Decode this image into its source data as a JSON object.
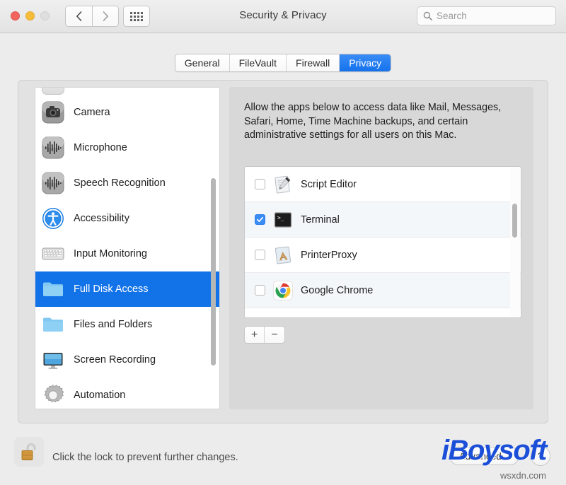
{
  "window": {
    "title": "Security & Privacy",
    "traffic_lights": [
      "close",
      "minimize",
      "zoom"
    ],
    "nav": {
      "back": "‹",
      "forward": "›",
      "grid": "grid-icon"
    }
  },
  "search": {
    "placeholder": "Search",
    "value": "",
    "icon": "search-icon"
  },
  "tabs": [
    {
      "label": "General",
      "active": false
    },
    {
      "label": "FileVault",
      "active": false
    },
    {
      "label": "Firewall",
      "active": false
    },
    {
      "label": "Privacy",
      "active": true
    }
  ],
  "sidebar": {
    "items": [
      {
        "label": "Camera",
        "icon": "camera-icon",
        "selected": false
      },
      {
        "label": "Microphone",
        "icon": "microphone-icon",
        "selected": false
      },
      {
        "label": "Speech Recognition",
        "icon": "speech-waveform-icon",
        "selected": false
      },
      {
        "label": "Accessibility",
        "icon": "accessibility-icon",
        "selected": false
      },
      {
        "label": "Input Monitoring",
        "icon": "keyboard-icon",
        "selected": false
      },
      {
        "label": "Full Disk Access",
        "icon": "folder-icon",
        "selected": true
      },
      {
        "label": "Files and Folders",
        "icon": "folder-icon",
        "selected": false
      },
      {
        "label": "Screen Recording",
        "icon": "display-icon",
        "selected": false
      },
      {
        "label": "Automation",
        "icon": "gear-icon",
        "selected": false
      }
    ]
  },
  "pane": {
    "description": "Allow the apps below to access data like Mail, Messages, Safari, Home, Time Machine backups, and certain administrative settings for all users on this Mac.",
    "apps": [
      {
        "name": "Script Editor",
        "icon": "script-editor-icon",
        "checked": false
      },
      {
        "name": "Terminal",
        "icon": "terminal-icon",
        "checked": true
      },
      {
        "name": "PrinterProxy",
        "icon": "printer-proxy-icon",
        "checked": false
      },
      {
        "name": "Google Chrome",
        "icon": "chrome-icon",
        "checked": false
      }
    ],
    "add_label": "+",
    "remove_label": "−"
  },
  "footer": {
    "lock_icon": "unlocked-padlock-icon",
    "lock_text": "Click the lock to prevent further changes.",
    "advanced_label": "Advanced...",
    "help_label": "?"
  },
  "watermark": {
    "logo": "iBoysoft",
    "url": "wsxdn.com"
  },
  "colors": {
    "accent": "#1272e8",
    "tab_active": "#2f7fe8",
    "checkbox_checked": "#3a8cf6",
    "window_bg": "#ececec",
    "panel_bg": "#e3e2e2",
    "watermark_blue": "#1b4fd8"
  }
}
